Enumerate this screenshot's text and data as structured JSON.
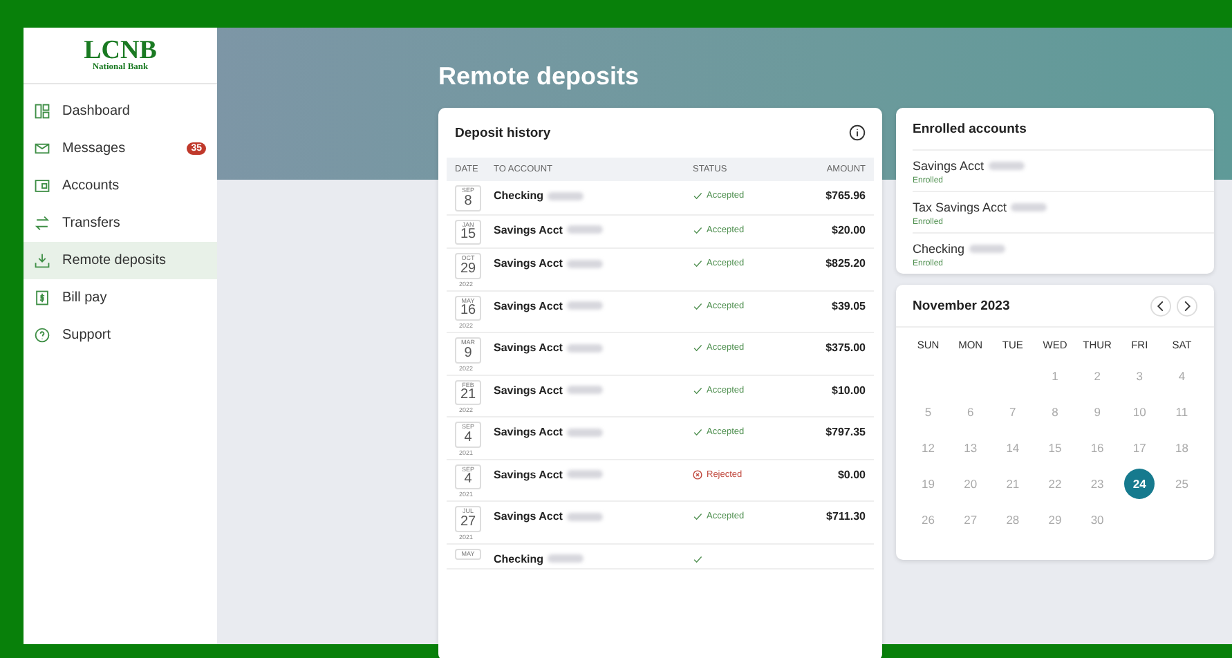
{
  "sidebar": {
    "logo": {
      "name": "LCNB",
      "tagline": "National Bank"
    },
    "items": [
      {
        "label": "Dashboard",
        "kind": "dashboard",
        "selected": false
      },
      {
        "label": "Messages",
        "kind": "mail",
        "selected": false,
        "badge": "35"
      },
      {
        "label": "Accounts",
        "kind": "accounts",
        "selected": false
      },
      {
        "label": "Transfers",
        "kind": "transfers",
        "selected": false
      },
      {
        "label": "Remote deposits",
        "kind": "deposit",
        "selected": true
      },
      {
        "label": "Bill pay",
        "kind": "bill",
        "selected": false
      },
      {
        "label": "Support",
        "kind": "help",
        "selected": false
      }
    ]
  },
  "page_title": "Remote deposits",
  "deposit_history": {
    "title": "Deposit history",
    "columns": [
      "DATE",
      "TO ACCOUNT",
      "STATUS",
      "AMOUNT"
    ],
    "rows": [
      {
        "month": "SEP",
        "day": "8",
        "account": "Checking",
        "masked": true,
        "status": "Accepted",
        "kind": "accepted",
        "amount": "$765.96"
      },
      {
        "month": "JAN",
        "day": "15",
        "account": "Savings Acct",
        "masked": true,
        "status": "Accepted",
        "kind": "accepted",
        "amount": "$20.00"
      },
      {
        "month": "OCT",
        "day": "29",
        "year": "2022",
        "account": "Savings Acct",
        "masked": true,
        "status": "Accepted",
        "kind": "accepted",
        "amount": "$825.20"
      },
      {
        "month": "MAY",
        "day": "16",
        "year": "2022",
        "account": "Savings Acct",
        "masked": true,
        "status": "Accepted",
        "kind": "accepted",
        "amount": "$39.05"
      },
      {
        "month": "MAR",
        "day": "9",
        "year": "2022",
        "account": "Savings Acct",
        "masked": true,
        "status": "Accepted",
        "kind": "accepted",
        "amount": "$375.00"
      },
      {
        "month": "FEB",
        "day": "21",
        "year": "2022",
        "account": "Savings Acct",
        "masked": true,
        "status": "Accepted",
        "kind": "accepted",
        "amount": "$10.00"
      },
      {
        "month": "SEP",
        "day": "4",
        "year": "2021",
        "account": "Savings Acct",
        "masked": true,
        "status": "Accepted",
        "kind": "accepted",
        "amount": "$797.35"
      },
      {
        "month": "SEP",
        "day": "4",
        "year": "2021",
        "account": "Savings Acct",
        "masked": true,
        "status": "Rejected",
        "kind": "rejected",
        "amount": "$0.00"
      },
      {
        "month": "JUL",
        "day": "27",
        "year": "2021",
        "account": "Savings Acct",
        "masked": true,
        "status": "Accepted",
        "kind": "accepted",
        "amount": "$711.30"
      },
      {
        "month": "MAY",
        "account": "Checking",
        "masked": true,
        "kind": "accepted"
      }
    ]
  },
  "enrolled_accounts": {
    "title": "Enrolled accounts",
    "items": [
      {
        "name": "Savings Acct",
        "masked": true,
        "status": "Enrolled"
      },
      {
        "name": "Tax Savings Acct",
        "masked": true,
        "status": "Enrolled"
      },
      {
        "name": "Checking",
        "masked": true,
        "status": "Enrolled"
      }
    ]
  },
  "calendar": {
    "title": "November 2023",
    "weekdays": [
      "SUN",
      "MON",
      "TUE",
      "WED",
      "THUR",
      "FRI",
      "SAT"
    ],
    "weeks": [
      {
        "days": [
          {
            "day": "1",
            "selected": false
          },
          {
            "day": "2",
            "selected": false
          },
          {
            "day": "3",
            "selected": false
          },
          {
            "day": "4",
            "selected": false
          }
        ]
      },
      {
        "days": [
          {
            "day": "5",
            "selected": false
          },
          {
            "day": "6",
            "selected": false
          },
          {
            "day": "7",
            "selected": false
          },
          {
            "day": "8",
            "selected": false
          },
          {
            "day": "9",
            "selected": false
          },
          {
            "day": "10",
            "selected": false
          },
          {
            "day": "11",
            "selected": false
          }
        ]
      },
      {
        "days": [
          {
            "day": "12",
            "selected": false
          },
          {
            "day": "13",
            "selected": false
          },
          {
            "day": "14",
            "selected": false
          },
          {
            "day": "15",
            "selected": false
          },
          {
            "day": "16",
            "selected": false
          },
          {
            "day": "17",
            "selected": false
          },
          {
            "day": "18",
            "selected": false
          }
        ]
      },
      {
        "days": [
          {
            "day": "19",
            "selected": false
          },
          {
            "day": "20",
            "selected": false
          },
          {
            "day": "21",
            "selected": false
          },
          {
            "day": "22",
            "selected": false
          },
          {
            "day": "23",
            "selected": false
          },
          {
            "day": "24",
            "selected": true
          },
          {
            "day": "25",
            "selected": false
          }
        ]
      },
      {
        "days": [
          {
            "day": "26",
            "selected": false
          },
          {
            "day": "27",
            "selected": false
          },
          {
            "day": "28",
            "selected": false
          },
          {
            "day": "29",
            "selected": false
          },
          {
            "day": "30",
            "selected": false
          }
        ]
      }
    ]
  }
}
